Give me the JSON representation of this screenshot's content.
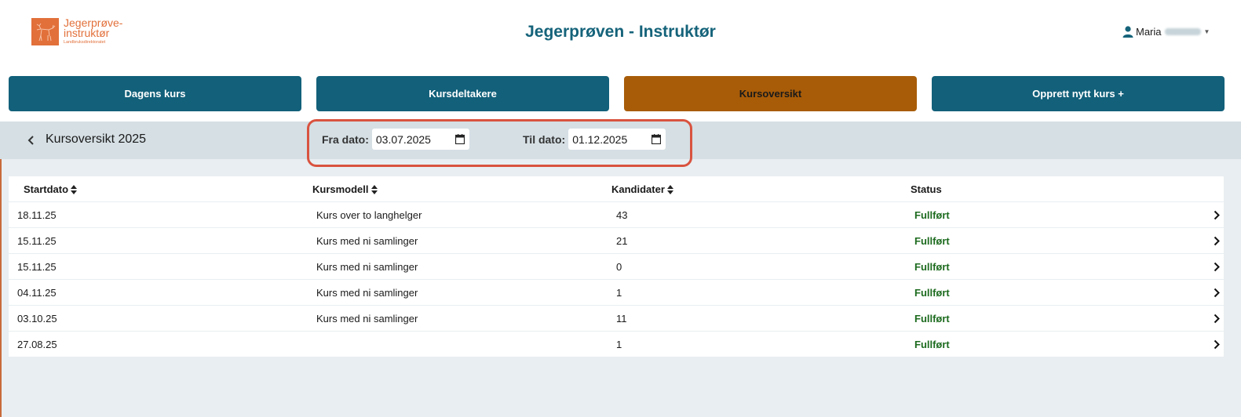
{
  "header": {
    "logo_line1": "Jegerprøve-",
    "logo_line2": "instruktør",
    "logo_sub": "Landbruksdirektoratet",
    "title": "Jegerprøven - Instruktør",
    "user_name": "Maria"
  },
  "nav": [
    {
      "label": "Dagens kurs",
      "active": false
    },
    {
      "label": "Kursdeltakere",
      "active": false
    },
    {
      "label": "Kursoversikt",
      "active": true
    },
    {
      "label": "Opprett nytt kurs +",
      "active": false
    }
  ],
  "filter": {
    "section_title": "Kursoversikt 2025",
    "from_label": "Fra dato:",
    "from_value": "03.07.2025",
    "to_label": "Til dato:",
    "to_value": "01.12.2025"
  },
  "table": {
    "headers": [
      "Startdato",
      "Kursmodell",
      "Kandidater",
      "Status"
    ],
    "rows": [
      {
        "start": "18.11.25",
        "model": "Kurs over to langhelger",
        "count": "43",
        "status": "Fullført"
      },
      {
        "start": "15.11.25",
        "model": "Kurs med ni samlinger",
        "count": "21",
        "status": "Fullført"
      },
      {
        "start": "15.11.25",
        "model": "Kurs med ni samlinger",
        "count": "0",
        "status": "Fullført"
      },
      {
        "start": "04.11.25",
        "model": "Kurs med ni samlinger",
        "count": "1",
        "status": "Fullført"
      },
      {
        "start": "03.10.25",
        "model": "Kurs med ni samlinger",
        "count": "11",
        "status": "Fullført"
      },
      {
        "start": "27.08.25",
        "model": "",
        "count": "1",
        "status": "Fullført"
      }
    ]
  },
  "colors": {
    "primary": "#12607a",
    "active_tab": "#a85c08",
    "brand_orange": "#e2703a",
    "status_green": "#1d6b1f",
    "highlight": "#d9533f"
  },
  "icons": [
    "user-icon",
    "caret-down-icon",
    "chevron-left-icon",
    "calendar-icon",
    "sort-icon",
    "chevron-right-icon"
  ]
}
